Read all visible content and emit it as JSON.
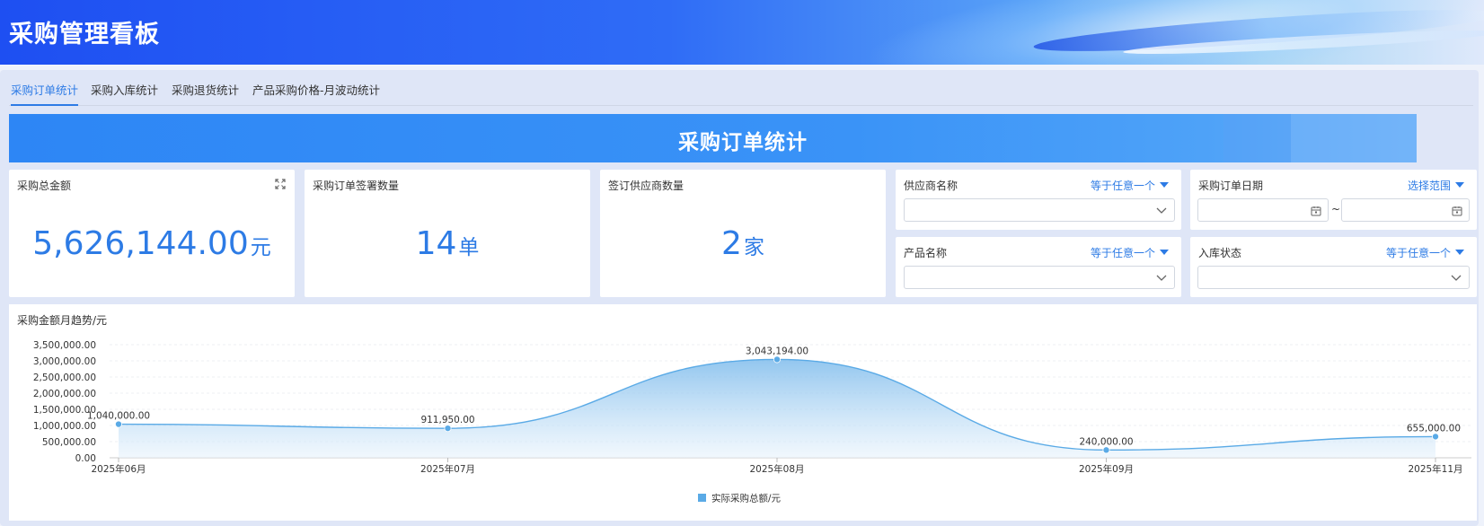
{
  "app": {
    "title": "采购管理看板"
  },
  "tabs": [
    {
      "label": "采购订单统计",
      "active": true
    },
    {
      "label": "采购入库统计",
      "active": false
    },
    {
      "label": "采购退货统计",
      "active": false
    },
    {
      "label": "产品采购价格-月波动统计",
      "active": false
    }
  ],
  "banner": {
    "title": "采购订单统计"
  },
  "kpis": {
    "total_amount": {
      "label": "采购总金额",
      "value": "5,626,144.00",
      "unit": "元"
    },
    "order_count": {
      "label": "采购订单签署数量",
      "value": "14",
      "unit": "单"
    },
    "supplier_count": {
      "label": "签订供应商数量",
      "value": "2",
      "unit": "家"
    }
  },
  "filters": {
    "supplier": {
      "label": "供应商名称",
      "mode": "等于任意一个",
      "value": ""
    },
    "order_date": {
      "label": "采购订单日期",
      "mode": "选择范围",
      "separator": "~",
      "start": "",
      "end": ""
    },
    "product": {
      "label": "产品名称",
      "mode": "等于任意一个",
      "value": ""
    },
    "stock_status": {
      "label": "入库状态",
      "mode": "等于任意一个",
      "value": ""
    }
  },
  "colors": {
    "accent": "#2d7be5",
    "series": "#5aaae6"
  },
  "icons": {
    "expand": "expand-icon",
    "chevron": "chevron-down-icon",
    "calendar": "calendar-icon",
    "caret": "caret-down-icon"
  },
  "chart_data": {
    "type": "area",
    "title": "采购金额月趋势/元",
    "x": [
      "2025年06月",
      "2025年07月",
      "2025年08月",
      "2025年09月",
      "2025年11月"
    ],
    "series": [
      {
        "name": "实际采购总额/元",
        "values": [
          1040000.0,
          911950.0,
          3043194.0,
          240000.0,
          655000.0
        ],
        "labels": [
          "1,040,000.00",
          "911,950.00",
          "3,043,194.00",
          "240,000.00",
          "655,000.00"
        ]
      }
    ],
    "y_ticks": [
      "0.00",
      "500,000.00",
      "1,000,000.00",
      "1,500,000.00",
      "2,000,000.00",
      "2,500,000.00",
      "3,000,000.00",
      "3,500,000.00"
    ],
    "ylim": [
      0,
      3500000
    ],
    "grid": true,
    "smooth": true,
    "legend": "bottom-center"
  }
}
